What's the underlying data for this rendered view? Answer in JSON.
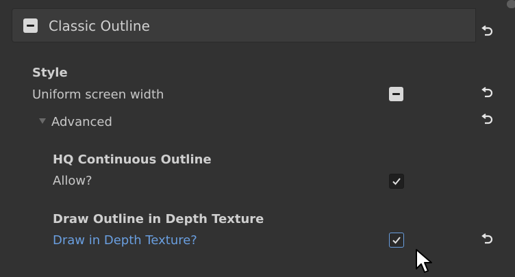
{
  "header": {
    "title": "Classic Outline"
  },
  "style_section": {
    "heading": "Style",
    "uniform_label": "Uniform screen width"
  },
  "advanced": {
    "label": "Advanced",
    "hq": {
      "heading": "HQ Continuous Outline",
      "field_label": "Allow?"
    },
    "depth": {
      "heading": "Draw Outline in Depth Texture",
      "field_label": "Draw in Depth Texture?"
    }
  },
  "icons": {
    "revert": "revert-icon",
    "checkmark": "checkmark-icon",
    "cursor": "mouse-pointer-icon"
  },
  "colors": {
    "panel_bg": "#323232",
    "header_bg": "#3b3b3b",
    "modified_blue": "#6a9fe0"
  }
}
